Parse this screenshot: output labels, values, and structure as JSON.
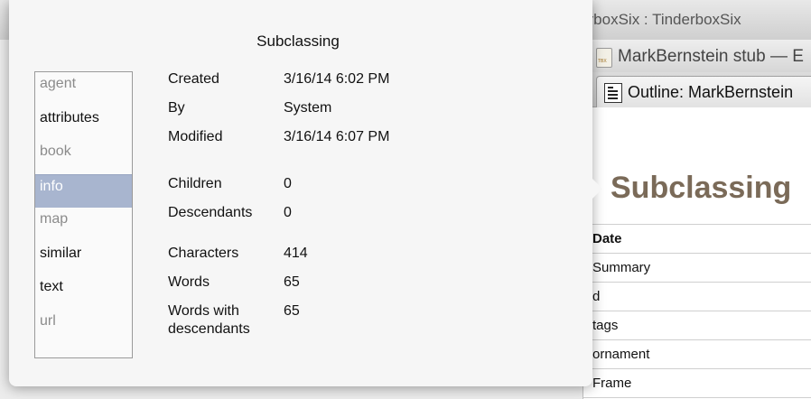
{
  "background": {
    "window_title": "Showing TinderboxSix : TinderboxSix"
  },
  "side_window": {
    "title": "MarkBernstein stub — E",
    "tab_label": "Outline: MarkBernstein",
    "heading": "Subclassing",
    "attributes": [
      "Date",
      "Summary",
      "d",
      "tags",
      "ornament",
      "Frame"
    ]
  },
  "popover": {
    "title": "Subclassing",
    "nav": [
      {
        "label": "agent",
        "state": "dim"
      },
      {
        "label": "attributes",
        "state": "normal"
      },
      {
        "label": "book",
        "state": "dim"
      },
      {
        "label": "info",
        "state": "selected"
      },
      {
        "label": "map",
        "state": "dim"
      },
      {
        "label": "similar",
        "state": "normal"
      },
      {
        "label": "text",
        "state": "normal"
      },
      {
        "label": "url",
        "state": "dim"
      }
    ],
    "info": {
      "created_label": "Created",
      "created_value": "3/16/14 6:02 PM",
      "by_label": "By",
      "by_value": "System",
      "modified_label": "Modified",
      "modified_value": "3/16/14 6:07 PM",
      "children_label": "Children",
      "children_value": "0",
      "descendants_label": "Descendants",
      "descendants_value": "0",
      "characters_label": "Characters",
      "characters_value": "414",
      "words_label": "Words",
      "words_value": "65",
      "words_desc_label_1": "Words with",
      "words_desc_label_2": "descendants",
      "words_desc_value": "65"
    }
  },
  "colors": {
    "selection": "#a8b5cf",
    "heading_brown": "#7a6a58"
  }
}
